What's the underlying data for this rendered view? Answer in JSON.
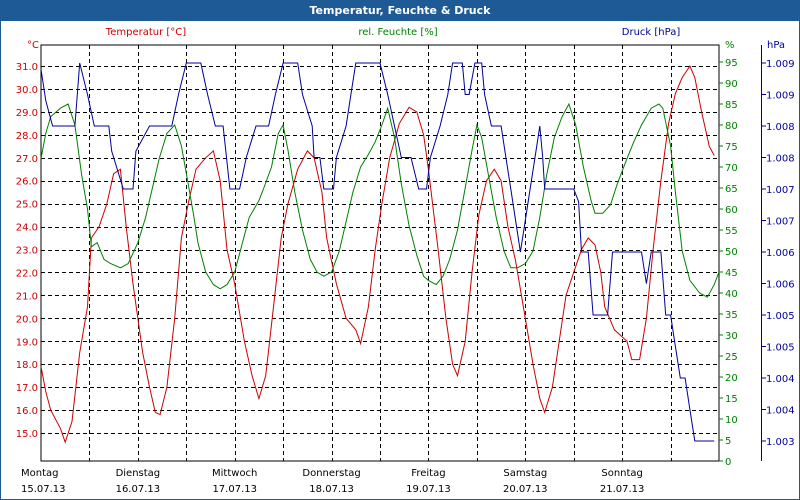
{
  "window": {
    "title": "Temperatur, Feuchte & Druck"
  },
  "chart_data": {
    "type": "line",
    "title": "Temperatur, Feuchte & Druck",
    "grid": true,
    "colors": {
      "temperature": "#cc0000",
      "humidity": "#008000",
      "pressure": "#000099",
      "grid": "#000000",
      "titlebar": "#1e5a96"
    },
    "x_range": [
      0,
      7
    ],
    "x_ticks": [
      {
        "x": 0,
        "day": "Montag",
        "date": "15.07.13"
      },
      {
        "x": 1,
        "day": "Dienstag",
        "date": "16.07.13"
      },
      {
        "x": 2,
        "day": "Mittwoch",
        "date": "17.07.13"
      },
      {
        "x": 3,
        "day": "Donnerstag",
        "date": "18.07.13"
      },
      {
        "x": 4,
        "day": "Freitag",
        "date": "19.07.13"
      },
      {
        "x": 5,
        "day": "Samstag",
        "date": "20.07.13"
      },
      {
        "x": 6,
        "day": "Sonntag",
        "date": "21.07.13"
      }
    ],
    "axes": {
      "temperature": {
        "label": "Temperatur [°C]",
        "unit": "°C",
        "range": [
          14.5,
          31.5
        ],
        "ticks": [
          "31.0",
          "30.0",
          "29.0",
          "28.0",
          "27.0",
          "26.0",
          "25.0",
          "24.0",
          "23.0",
          "22.0",
          "21.0",
          "20.0",
          "19.0",
          "18.0",
          "17.0",
          "16.0",
          "15.0"
        ]
      },
      "humidity": {
        "label": "rel. Feuchte [%]",
        "unit": "%",
        "range": [
          0,
          100
        ],
        "ticks": [
          "95",
          "90",
          "85",
          "80",
          "75",
          "70",
          "65",
          "60",
          "55",
          "50",
          "45",
          "40",
          "35",
          "30",
          "25",
          "20",
          "15",
          "10",
          "5",
          "0"
        ]
      },
      "pressure": {
        "label": "Druck [hPa]",
        "unit": "hPa",
        "ticks": [
          "1.009",
          "1.009",
          "1.008",
          "1.008",
          "1.007",
          "1.007",
          "1.006",
          "1.006",
          "1.005",
          "1.005",
          "1.004",
          "1.004",
          "1.003"
        ]
      }
    },
    "series": [
      {
        "name": "Temperatur [°C]",
        "axis": "temperature",
        "points": [
          [
            0,
            17.9
          ],
          [
            0.05,
            16.8
          ],
          [
            0.1,
            16.0
          ],
          [
            0.2,
            15.2
          ],
          [
            0.25,
            14.6
          ],
          [
            0.32,
            15.5
          ],
          [
            0.4,
            18.5
          ],
          [
            0.48,
            20.5
          ],
          [
            0.52,
            23.5
          ],
          [
            0.6,
            24.0
          ],
          [
            0.68,
            25.0
          ],
          [
            0.75,
            26.3
          ],
          [
            0.82,
            26.5
          ],
          [
            0.88,
            24.0
          ],
          [
            0.95,
            21.5
          ],
          [
            1.05,
            18.5
          ],
          [
            1.12,
            17.0
          ],
          [
            1.18,
            15.9
          ],
          [
            1.23,
            15.8
          ],
          [
            1.3,
            17.0
          ],
          [
            1.38,
            20.0
          ],
          [
            1.45,
            23.5
          ],
          [
            1.52,
            25.0
          ],
          [
            1.6,
            26.5
          ],
          [
            1.7,
            27.0
          ],
          [
            1.78,
            27.3
          ],
          [
            1.85,
            26.0
          ],
          [
            1.92,
            23.0
          ],
          [
            2.0,
            21.5
          ],
          [
            2.1,
            19.0
          ],
          [
            2.18,
            17.5
          ],
          [
            2.25,
            16.5
          ],
          [
            2.32,
            17.5
          ],
          [
            2.4,
            20.5
          ],
          [
            2.48,
            23.5
          ],
          [
            2.55,
            25.0
          ],
          [
            2.65,
            26.5
          ],
          [
            2.75,
            27.3
          ],
          [
            2.82,
            27.0
          ],
          [
            2.9,
            25.5
          ],
          [
            2.95,
            23.5
          ],
          [
            3.05,
            21.5
          ],
          [
            3.15,
            20.0
          ],
          [
            3.25,
            19.5
          ],
          [
            3.3,
            18.9
          ],
          [
            3.38,
            20.5
          ],
          [
            3.45,
            23.0
          ],
          [
            3.52,
            25.0
          ],
          [
            3.6,
            27.0
          ],
          [
            3.7,
            28.5
          ],
          [
            3.8,
            29.2
          ],
          [
            3.88,
            29.0
          ],
          [
            3.95,
            28.0
          ],
          [
            4.0,
            26.5
          ],
          [
            4.1,
            23.0
          ],
          [
            4.18,
            20.0
          ],
          [
            4.25,
            18.0
          ],
          [
            4.3,
            17.5
          ],
          [
            4.38,
            19.0
          ],
          [
            4.45,
            22.0
          ],
          [
            4.52,
            24.5
          ],
          [
            4.6,
            26.0
          ],
          [
            4.68,
            26.5
          ],
          [
            4.75,
            26.0
          ],
          [
            4.82,
            24.0
          ],
          [
            4.9,
            22.5
          ],
          [
            5.0,
            20.0
          ],
          [
            5.08,
            18.0
          ],
          [
            5.15,
            16.5
          ],
          [
            5.2,
            15.9
          ],
          [
            5.28,
            17.0
          ],
          [
            5.35,
            19.0
          ],
          [
            5.42,
            21.0
          ],
          [
            5.5,
            22.0
          ],
          [
            5.58,
            23.0
          ],
          [
            5.65,
            23.5
          ],
          [
            5.72,
            23.2
          ],
          [
            5.78,
            22.0
          ],
          [
            5.82,
            20.5
          ],
          [
            5.92,
            19.5
          ],
          [
            6.05,
            19.0
          ],
          [
            6.1,
            18.2
          ],
          [
            6.18,
            18.2
          ],
          [
            6.25,
            20.0
          ],
          [
            6.32,
            23.0
          ],
          [
            6.4,
            26.0
          ],
          [
            6.48,
            28.5
          ],
          [
            6.55,
            29.8
          ],
          [
            6.62,
            30.5
          ],
          [
            6.7,
            31.0
          ],
          [
            6.75,
            30.5
          ],
          [
            6.82,
            29.0
          ],
          [
            6.9,
            27.5
          ],
          [
            6.95,
            27.1
          ]
        ]
      },
      {
        "name": "rel. Feuchte [%]",
        "axis": "humidity",
        "points": [
          [
            0,
            72
          ],
          [
            0.05,
            78
          ],
          [
            0.1,
            82
          ],
          [
            0.2,
            84
          ],
          [
            0.28,
            85
          ],
          [
            0.35,
            80
          ],
          [
            0.42,
            68
          ],
          [
            0.48,
            60
          ],
          [
            0.52,
            51
          ],
          [
            0.58,
            52
          ],
          [
            0.65,
            48
          ],
          [
            0.72,
            47
          ],
          [
            0.82,
            46
          ],
          [
            0.9,
            47
          ],
          [
            1.0,
            52
          ],
          [
            1.08,
            58
          ],
          [
            1.15,
            65
          ],
          [
            1.22,
            72
          ],
          [
            1.3,
            78
          ],
          [
            1.38,
            80
          ],
          [
            1.45,
            75
          ],
          [
            1.52,
            66
          ],
          [
            1.58,
            58
          ],
          [
            1.62,
            52
          ],
          [
            1.7,
            45
          ],
          [
            1.78,
            42
          ],
          [
            1.85,
            41
          ],
          [
            1.92,
            42
          ],
          [
            2.0,
            45
          ],
          [
            2.08,
            52
          ],
          [
            2.15,
            58
          ],
          [
            2.25,
            62
          ],
          [
            2.3,
            65
          ],
          [
            2.38,
            70
          ],
          [
            2.45,
            78
          ],
          [
            2.5,
            80
          ],
          [
            2.55,
            74
          ],
          [
            2.62,
            64
          ],
          [
            2.7,
            55
          ],
          [
            2.78,
            48
          ],
          [
            2.85,
            45
          ],
          [
            2.92,
            44
          ],
          [
            3.0,
            45
          ],
          [
            3.08,
            50
          ],
          [
            3.15,
            57
          ],
          [
            3.22,
            64
          ],
          [
            3.3,
            70
          ],
          [
            3.38,
            73
          ],
          [
            3.45,
            76
          ],
          [
            3.52,
            80
          ],
          [
            3.58,
            84
          ],
          [
            3.65,
            77
          ],
          [
            3.72,
            66
          ],
          [
            3.8,
            56
          ],
          [
            3.88,
            49
          ],
          [
            3.95,
            44
          ],
          [
            4.0,
            43
          ],
          [
            4.08,
            42
          ],
          [
            4.15,
            44
          ],
          [
            4.22,
            48
          ],
          [
            4.3,
            55
          ],
          [
            4.38,
            65
          ],
          [
            4.45,
            74
          ],
          [
            4.5,
            80
          ],
          [
            4.55,
            77
          ],
          [
            4.62,
            68
          ],
          [
            4.7,
            58
          ],
          [
            4.78,
            50
          ],
          [
            4.85,
            46
          ],
          [
            4.92,
            46
          ],
          [
            5.0,
            47
          ],
          [
            5.08,
            50
          ],
          [
            5.15,
            58
          ],
          [
            5.22,
            68
          ],
          [
            5.3,
            77
          ],
          [
            5.38,
            82
          ],
          [
            5.45,
            85
          ],
          [
            5.52,
            80
          ],
          [
            5.6,
            70
          ],
          [
            5.68,
            62
          ],
          [
            5.72,
            59
          ],
          [
            5.8,
            59
          ],
          [
            5.88,
            61
          ],
          [
            5.95,
            66
          ],
          [
            6.05,
            72
          ],
          [
            6.12,
            76
          ],
          [
            6.2,
            80
          ],
          [
            6.3,
            84
          ],
          [
            6.38,
            85
          ],
          [
            6.42,
            84
          ],
          [
            6.5,
            75
          ],
          [
            6.55,
            64
          ],
          [
            6.62,
            50
          ],
          [
            6.7,
            43
          ],
          [
            6.8,
            40
          ],
          [
            6.88,
            39
          ],
          [
            6.95,
            42
          ],
          [
            7.0,
            45
          ]
        ]
      },
      {
        "name": "Druck [hPa]",
        "axis": "pressure",
        "points": [
          [
            0,
            1008.9
          ],
          [
            0.05,
            1008.4
          ],
          [
            0.12,
            1008.0
          ],
          [
            0.18,
            1008.0
          ],
          [
            0.25,
            1008.0
          ],
          [
            0.35,
            1008.0
          ],
          [
            0.4,
            1009.0
          ],
          [
            0.48,
            1008.5
          ],
          [
            0.55,
            1008.0
          ],
          [
            0.7,
            1008.0
          ],
          [
            0.73,
            1007.6
          ],
          [
            0.85,
            1007.0
          ],
          [
            0.95,
            1007.0
          ],
          [
            0.98,
            1007.6
          ],
          [
            1.12,
            1008.0
          ],
          [
            1.25,
            1008.0
          ],
          [
            1.35,
            1008.0
          ],
          [
            1.42,
            1008.5
          ],
          [
            1.5,
            1009.0
          ],
          [
            1.65,
            1009.0
          ],
          [
            1.72,
            1008.5
          ],
          [
            1.8,
            1008.0
          ],
          [
            1.88,
            1008.0
          ],
          [
            1.95,
            1007.0
          ],
          [
            2.05,
            1007.0
          ],
          [
            2.12,
            1007.5
          ],
          [
            2.22,
            1008.0
          ],
          [
            2.35,
            1008.0
          ],
          [
            2.42,
            1008.5
          ],
          [
            2.5,
            1009.0
          ],
          [
            2.65,
            1009.0
          ],
          [
            2.7,
            1008.5
          ],
          [
            2.8,
            1008.0
          ],
          [
            2.82,
            1007.5
          ],
          [
            2.88,
            1007.5
          ],
          [
            2.92,
            1007.0
          ],
          [
            3.02,
            1007.0
          ],
          [
            3.05,
            1007.5
          ],
          [
            3.15,
            1008.0
          ],
          [
            3.2,
            1008.5
          ],
          [
            3.25,
            1009.0
          ],
          [
            3.5,
            1009.0
          ],
          [
            3.58,
            1008.5
          ],
          [
            3.65,
            1008.0
          ],
          [
            3.72,
            1007.5
          ],
          [
            3.82,
            1007.5
          ],
          [
            3.9,
            1007.0
          ],
          [
            3.98,
            1007.0
          ],
          [
            4.02,
            1007.5
          ],
          [
            4.12,
            1008.0
          ],
          [
            4.2,
            1008.5
          ],
          [
            4.25,
            1009.0
          ],
          [
            4.35,
            1009.0
          ],
          [
            4.38,
            1008.5
          ],
          [
            4.42,
            1008.5
          ],
          [
            4.48,
            1009.0
          ],
          [
            4.55,
            1009.0
          ],
          [
            4.58,
            1008.5
          ],
          [
            4.65,
            1008.0
          ],
          [
            4.75,
            1008.0
          ],
          [
            4.8,
            1007.5
          ],
          [
            4.85,
            1007.0
          ],
          [
            4.9,
            1006.5
          ],
          [
            4.95,
            1006.0
          ],
          [
            5.0,
            1006.5
          ],
          [
            5.05,
            1007.0
          ],
          [
            5.1,
            1007.5
          ],
          [
            5.15,
            1008.0
          ],
          [
            5.18,
            1007.5
          ],
          [
            5.2,
            1007.0
          ],
          [
            5.5,
            1007.0
          ],
          [
            5.55,
            1006.8
          ],
          [
            5.58,
            1006.0
          ],
          [
            5.65,
            1006.0
          ],
          [
            5.7,
            1005.0
          ],
          [
            5.85,
            1005.0
          ],
          [
            5.9,
            1006.0
          ],
          [
            6.2,
            1006.0
          ],
          [
            6.25,
            1005.5
          ],
          [
            6.3,
            1006.0
          ],
          [
            6.4,
            1006.0
          ],
          [
            6.45,
            1005.0
          ],
          [
            6.5,
            1005.0
          ],
          [
            6.55,
            1004.5
          ],
          [
            6.6,
            1004.0
          ],
          [
            6.65,
            1004.0
          ],
          [
            6.7,
            1003.5
          ],
          [
            6.75,
            1003.0
          ],
          [
            6.95,
            1003.0
          ]
        ]
      }
    ]
  }
}
